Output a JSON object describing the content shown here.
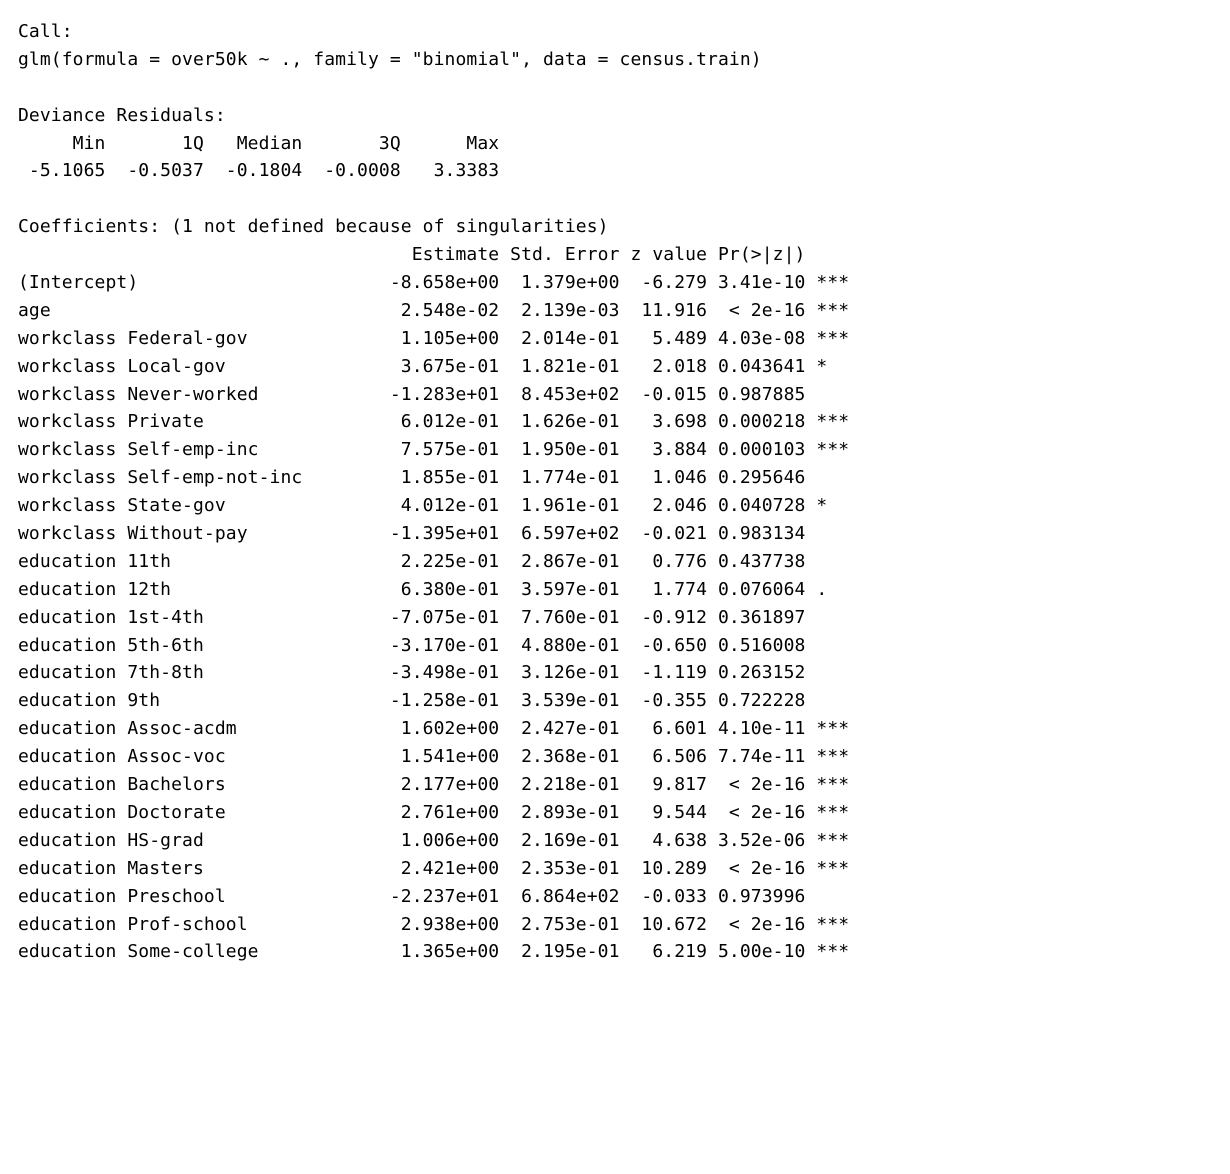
{
  "call_label": "Call:",
  "call_text": "glm(formula = over50k ~ ., family = \"binomial\", data = census.train)",
  "dev_res_label": "Deviance Residuals:",
  "dev_res_headers": [
    "Min",
    "1Q",
    "Median",
    "3Q",
    "Max"
  ],
  "dev_res_values": [
    "-5.1065",
    "-0.5037",
    "-0.1804",
    "-0.0008",
    "3.3383"
  ],
  "coef_label": "Coefficients: (1 not defined because of singularities)",
  "coef_headers": [
    "Estimate",
    "Std. Error",
    "z value",
    "Pr(>|z|)"
  ],
  "rows": [
    {
      "term": "(Intercept)",
      "est": "-8.658e+00",
      "se": "1.379e+00",
      "z": "-6.279",
      "p": "3.41e-10",
      "sig": "***"
    },
    {
      "term": "age",
      "est": "2.548e-02",
      "se": "2.139e-03",
      "z": "11.916",
      "p": "< 2e-16",
      "sig": "***"
    },
    {
      "term": "workclass Federal-gov",
      "est": "1.105e+00",
      "se": "2.014e-01",
      "z": "5.489",
      "p": "4.03e-08",
      "sig": "***"
    },
    {
      "term": "workclass Local-gov",
      "est": "3.675e-01",
      "se": "1.821e-01",
      "z": "2.018",
      "p": "0.043641",
      "sig": "*"
    },
    {
      "term": "workclass Never-worked",
      "est": "-1.283e+01",
      "se": "8.453e+02",
      "z": "-0.015",
      "p": "0.987885",
      "sig": ""
    },
    {
      "term": "workclass Private",
      "est": "6.012e-01",
      "se": "1.626e-01",
      "z": "3.698",
      "p": "0.000218",
      "sig": "***"
    },
    {
      "term": "workclass Self-emp-inc",
      "est": "7.575e-01",
      "se": "1.950e-01",
      "z": "3.884",
      "p": "0.000103",
      "sig": "***"
    },
    {
      "term": "workclass Self-emp-not-inc",
      "est": "1.855e-01",
      "se": "1.774e-01",
      "z": "1.046",
      "p": "0.295646",
      "sig": ""
    },
    {
      "term": "workclass State-gov",
      "est": "4.012e-01",
      "se": "1.961e-01",
      "z": "2.046",
      "p": "0.040728",
      "sig": "*"
    },
    {
      "term": "workclass Without-pay",
      "est": "-1.395e+01",
      "se": "6.597e+02",
      "z": "-0.021",
      "p": "0.983134",
      "sig": ""
    },
    {
      "term": "education 11th",
      "est": "2.225e-01",
      "se": "2.867e-01",
      "z": "0.776",
      "p": "0.437738",
      "sig": ""
    },
    {
      "term": "education 12th",
      "est": "6.380e-01",
      "se": "3.597e-01",
      "z": "1.774",
      "p": "0.076064",
      "sig": "."
    },
    {
      "term": "education 1st-4th",
      "est": "-7.075e-01",
      "se": "7.760e-01",
      "z": "-0.912",
      "p": "0.361897",
      "sig": ""
    },
    {
      "term": "education 5th-6th",
      "est": "-3.170e-01",
      "se": "4.880e-01",
      "z": "-0.650",
      "p": "0.516008",
      "sig": ""
    },
    {
      "term": "education 7th-8th",
      "est": "-3.498e-01",
      "se": "3.126e-01",
      "z": "-1.119",
      "p": "0.263152",
      "sig": ""
    },
    {
      "term": "education 9th",
      "est": "-1.258e-01",
      "se": "3.539e-01",
      "z": "-0.355",
      "p": "0.722228",
      "sig": ""
    },
    {
      "term": "education Assoc-acdm",
      "est": "1.602e+00",
      "se": "2.427e-01",
      "z": "6.601",
      "p": "4.10e-11",
      "sig": "***"
    },
    {
      "term": "education Assoc-voc",
      "est": "1.541e+00",
      "se": "2.368e-01",
      "z": "6.506",
      "p": "7.74e-11",
      "sig": "***"
    },
    {
      "term": "education Bachelors",
      "est": "2.177e+00",
      "se": "2.218e-01",
      "z": "9.817",
      "p": "< 2e-16",
      "sig": "***"
    },
    {
      "term": "education Doctorate",
      "est": "2.761e+00",
      "se": "2.893e-01",
      "z": "9.544",
      "p": "< 2e-16",
      "sig": "***"
    },
    {
      "term": "education HS-grad",
      "est": "1.006e+00",
      "se": "2.169e-01",
      "z": "4.638",
      "p": "3.52e-06",
      "sig": "***"
    },
    {
      "term": "education Masters",
      "est": "2.421e+00",
      "se": "2.353e-01",
      "z": "10.289",
      "p": "< 2e-16",
      "sig": "***"
    },
    {
      "term": "education Preschool",
      "est": "-2.237e+01",
      "se": "6.864e+02",
      "z": "-0.033",
      "p": "0.973996",
      "sig": ""
    },
    {
      "term": "education Prof-school",
      "est": "2.938e+00",
      "se": "2.753e-01",
      "z": "10.672",
      "p": "< 2e-16",
      "sig": "***"
    },
    {
      "term": "education Some-college",
      "est": "1.365e+00",
      "se": "2.195e-01",
      "z": "6.219",
      "p": "5.00e-10",
      "sig": "***"
    }
  ],
  "col_widths": {
    "label": 33,
    "est": 11,
    "se": 11,
    "z": 8,
    "p": 9,
    "sig": 4
  }
}
